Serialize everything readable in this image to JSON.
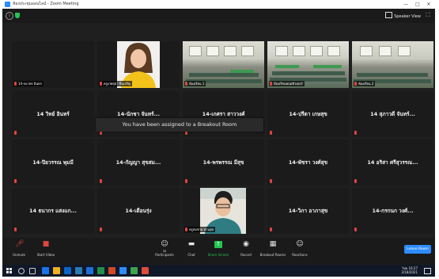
{
  "window": {
    "title": "ห้องประชุมออนไลน์ - Zoom Meeting",
    "minimize": "—",
    "maximize": "□",
    "close": "✕"
  },
  "topbar": {
    "view_label": "Speaker View"
  },
  "toast": "You have been assigned to a Breakout Room",
  "tiles": [
    {
      "id": "r1c1",
      "label": "14-จนาพร อินทร"
    },
    {
      "id": "r1c2",
      "label": "ครูเกศสุดา ปิ่นเจริญ"
    },
    {
      "id": "r1c3",
      "label": "ห้องเรียน 1"
    },
    {
      "id": "r1c4",
      "label": "ห้องเรียนคอมพิวเตอร์"
    },
    {
      "id": "r1c5",
      "label": "ห้องเรียน 2"
    },
    {
      "id": "r2c1",
      "name": "14 วิทย์ อินทร์"
    },
    {
      "id": "r2c2",
      "name": "14-นักชา จันทร์..."
    },
    {
      "id": "r2c3",
      "name": "14-เกศรา สาววงศ์"
    },
    {
      "id": "r2c4",
      "name": "14-ปรีดา เกษสุข"
    },
    {
      "id": "r2c5",
      "name": "14 สุภาวดี จันทร์..."
    },
    {
      "id": "r3c1",
      "name": "14-ปิยวรรณ พุมมี"
    },
    {
      "id": "r3c2",
      "name": "14-กัญญา สุขสม..."
    },
    {
      "id": "r3c3",
      "name": "14-พรพรรณ มีสุข"
    },
    {
      "id": "r3c4",
      "name": "14-พัชรา วงศ์สุข"
    },
    {
      "id": "r3c5",
      "name": "14 อริสา ศรีสุวรรณ..."
    },
    {
      "id": "r4c1",
      "name": "14 ธนากร แสงแก..."
    },
    {
      "id": "r4c2",
      "name": "14-เดือนรุ่ง"
    },
    {
      "id": "r4c3",
      "label": "ครูสมชาย พานสุข"
    },
    {
      "id": "r4c4",
      "name": "14-วิภา อาภาสุข"
    },
    {
      "id": "r4c5",
      "name": "14-กรกนก วงศ์..."
    }
  ],
  "toolbar": {
    "unmute": "Unmute",
    "start_video": "Start Video",
    "participants": "Participants",
    "participants_count": "20",
    "chat": "Chat",
    "share_screen": "Share Screen",
    "record": "Record",
    "breakout": "Breakout Rooms",
    "reactions": "Reactions",
    "leave": "Leave Room"
  },
  "taskbar": {
    "time": "16:27",
    "date": "2/18/2021",
    "lang": "ไทย"
  },
  "colors": {
    "accent": "#2d8cff",
    "active_speaker": "#c9de2e",
    "muted": "#e0453d",
    "share_green": "#23c552"
  }
}
